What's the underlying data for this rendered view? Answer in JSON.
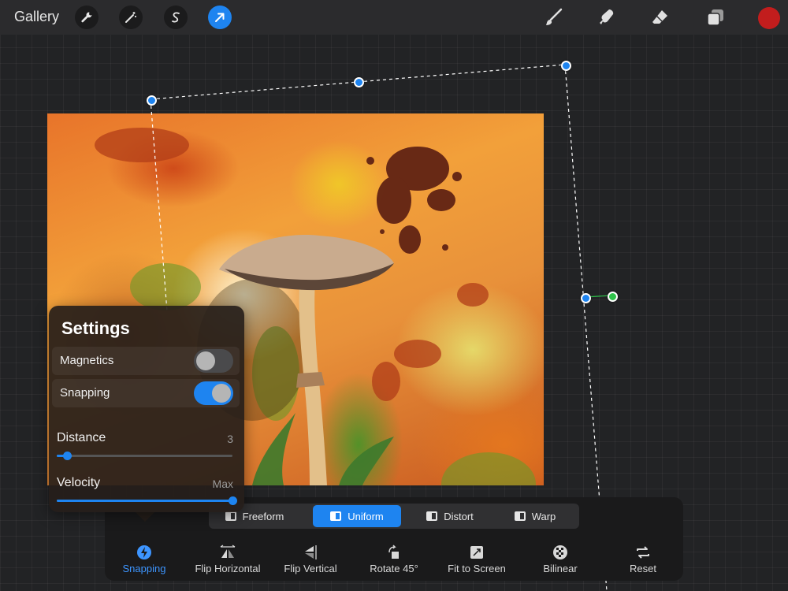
{
  "topbar": {
    "gallery_label": "Gallery",
    "left_tools": [
      "wrench-icon",
      "magic-wand-icon",
      "selection-icon",
      "transform-arrow-icon"
    ],
    "right_tools": [
      "brush-icon",
      "smudge-icon",
      "eraser-icon",
      "layers-icon"
    ],
    "current_color": "#c21d1d",
    "accent": "#1e84f0"
  },
  "settings": {
    "title": "Settings",
    "magnetics": {
      "label": "Magnetics",
      "on": false
    },
    "snapping": {
      "label": "Snapping",
      "on": true
    },
    "distance": {
      "label": "Distance",
      "value": "3",
      "fraction": 0.06
    },
    "velocity": {
      "label": "Velocity",
      "value": "Max",
      "fraction": 1.0
    }
  },
  "modes": [
    {
      "label": "Freeform",
      "active": false
    },
    {
      "label": "Uniform",
      "active": true
    },
    {
      "label": "Distort",
      "active": false
    },
    {
      "label": "Warp",
      "active": false
    }
  ],
  "actions": [
    {
      "label": "Snapping",
      "icon": "snapping-icon",
      "active": true
    },
    {
      "label": "Flip Horizontal",
      "icon": "flip-horizontal-icon",
      "active": false
    },
    {
      "label": "Flip Vertical",
      "icon": "flip-vertical-icon",
      "active": false
    },
    {
      "label": "Rotate 45°",
      "icon": "rotate-icon",
      "active": false
    },
    {
      "label": "Fit to Screen",
      "icon": "fit-to-screen-icon",
      "active": false
    },
    {
      "label": "Bilinear",
      "icon": "bilinear-icon",
      "active": false
    },
    {
      "label": "Reset",
      "icon": "reset-icon",
      "active": false
    }
  ]
}
